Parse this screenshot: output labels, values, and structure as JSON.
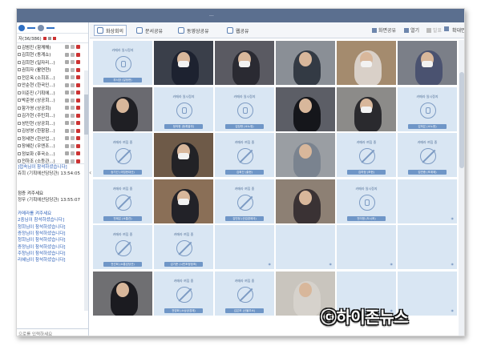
{
  "window": {
    "title_text": "...",
    "top_items": [
      "",
      "",
      ""
    ]
  },
  "sidebar": {
    "members_count": "자(36/386)",
    "members": [
      {
        "name": "김범진 (함께해)"
      },
      {
        "name": "김희현 (동계쇼)"
      },
      {
        "name": "김희현 (일자리...)"
      },
      {
        "name": "권희자 (활연현)"
      },
      {
        "name": "전은옥 (소희조...)"
      },
      {
        "name": "안순현 (한국인...)"
      },
      {
        "name": "이준진 (기획에...)"
      },
      {
        "name": "박준영 (상공회...)"
      },
      {
        "name": "함가영 (상공회)"
      },
      {
        "name": "김가현 (주민회...)"
      },
      {
        "name": "성민현 (상공회...)"
      },
      {
        "name": "김성영 (한함함...)"
      },
      {
        "name": "정세연 (한산업...)"
      },
      {
        "name": "장혜린 (우엔조...)"
      },
      {
        "name": "정보화 (후국소...)"
      },
      {
        "name": "전하조 (소등관...)"
      },
      {
        "name": "정지희 (신문화...)"
      },
      {
        "name": "박주영 (건설과)"
      },
      {
        "name": "정인정 (신년...)"
      }
    ],
    "chat_lines": [
      {
        "text": "]접속님이 참석하셨습니다]",
        "color": "blue"
      },
      {
        "text": "쥬희 (기획에산담당관) 13:54:05",
        "color": "dark"
      },
      {
        "text": "",
        "color": "blk"
      },
      {
        "text": "",
        "color": "blk"
      },
      {
        "text": "점증 켜주세요",
        "color": "blk"
      },
      {
        "text": "정무 (기획에산담당관) 13:55:07",
        "color": "dark"
      },
      {
        "text": "",
        "color": "blk"
      },
      {
        "text": "카메라를 켜주세요",
        "color": "blue"
      },
      {
        "text": "2중님이 참석하셨습니다]",
        "color": "blue"
      },
      {
        "text": "청희님이 참석하셨습니다]",
        "color": "blue"
      },
      {
        "text": "증정님이 참석하셨습니다]",
        "color": "blue"
      },
      {
        "text": "청희님이 참석하셨습니다]",
        "color": "blue"
      },
      {
        "text": "증정님이 참석하셨습니다]",
        "color": "blue"
      },
      {
        "text": "주청님이 참석하셨습니다]",
        "color": "blue"
      },
      {
        "text": "리혜님이 참석하셨습니다]",
        "color": "blue"
      }
    ],
    "chat_placeholder": "으로를 입력하세요"
  },
  "toolbar": {
    "tabs": [
      {
        "label": "화상회의",
        "active": true
      },
      {
        "label": "문서공유",
        "active": false
      },
      {
        "label": "동영상공유",
        "active": false
      },
      {
        "label": "웹공유",
        "active": false
      }
    ],
    "right": [
      "화면공유",
      "열기",
      "발표",
      "",
      "확대면"
    ]
  },
  "tiles": [
    {
      "state": "off",
      "caption": "카메라 일시정지",
      "icon": "person",
      "label": "부서장 (일정현)"
    },
    {
      "state": "video",
      "bg": "#3a3f4a",
      "body": "#1d2230",
      "label": ""
    },
    {
      "state": "video",
      "bg": "#5a5a62",
      "body": "#2a2a32",
      "label": ""
    },
    {
      "state": "video",
      "bg": "#8a8f96",
      "body": "#333a44",
      "label": ""
    },
    {
      "state": "video",
      "bg": "#a48b6e",
      "body": "#d9d0c8",
      "label": ""
    },
    {
      "state": "video",
      "bg": "#7b7f88",
      "body": "#4a5270",
      "label": ""
    },
    {
      "state": "video",
      "bg": "#6a6a70",
      "body": "#1f1f24",
      "label": ""
    },
    {
      "state": "off",
      "caption": "카메라 일시정지",
      "icon": "person",
      "label": "정의현 (등록출부)"
    },
    {
      "state": "off",
      "caption": "카메라 일시정지",
      "icon": "person",
      "label": "김당현 (소노정)"
    },
    {
      "state": "video",
      "bg": "#5c5e66",
      "body": "#15161b",
      "label": ""
    },
    {
      "state": "video",
      "bg": "#8c8b89",
      "body": "#2a2a2e",
      "label": ""
    },
    {
      "state": "off",
      "caption": "카메라 일시정지",
      "icon": "person",
      "label": "김하은 (소노현)"
    },
    {
      "state": "off",
      "caption": "카메라 꺼짐 중",
      "icon": "slash",
      "label": "송기선 (국립현대산)"
    },
    {
      "state": "video",
      "bg": "#6e5a48",
      "body": "#222226",
      "label": ""
    },
    {
      "state": "off",
      "caption": "카메라 꺼짐 중",
      "icon": "slash",
      "label": "김희진 (출현)"
    },
    {
      "state": "video",
      "bg": "#9a9ea3",
      "body": "#7a838f",
      "label": ""
    },
    {
      "state": "off",
      "caption": "카메라 꺼짐 중",
      "icon": "slash",
      "label": "김하정 (조현)"
    },
    {
      "state": "off",
      "caption": "카메라 꺼짐 중",
      "icon": "slash",
      "label": "김연중 (조계제)"
    },
    {
      "state": "off",
      "caption": "카메라 꺼짐 중",
      "icon": "slash",
      "label": "전제은 (소통관)"
    },
    {
      "state": "video",
      "bg": "#8a6f57",
      "body": "#222228",
      "label": ""
    },
    {
      "state": "off",
      "caption": "카메라 꺼짐 중",
      "icon": "slash",
      "label": "김민정 (산업경제국)"
    },
    {
      "state": "video",
      "bg": "#8d8074",
      "body": "#3a3234",
      "label": ""
    },
    {
      "state": "off",
      "caption": "카메라 일시정지",
      "icon": "person",
      "label": "전이정 (도시조)"
    },
    {
      "state": "off",
      "caption": "",
      "icon": "wm",
      "label": ""
    },
    {
      "state": "off",
      "caption": "카메라 꺼짐 중",
      "icon": "slash",
      "label": "전선희 (소통담당관)"
    },
    {
      "state": "off",
      "caption": "카메라 꺼짐 중",
      "icon": "slash",
      "label": "김기준 (시민조정정조)"
    },
    {
      "state": "off",
      "caption": "",
      "icon": "wm",
      "label": ""
    },
    {
      "state": "off",
      "caption": "",
      "icon": "wm",
      "label": ""
    },
    {
      "state": "off",
      "caption": "",
      "icon": "wm",
      "label": ""
    },
    {
      "state": "off",
      "caption": "",
      "icon": "wm",
      "label": ""
    },
    {
      "state": "video",
      "bg": "#6f6f72",
      "body": "#1b1b20",
      "label": ""
    },
    {
      "state": "off",
      "caption": "카메라 꺼짐 중",
      "icon": "slash",
      "label": "전영화 (소상공경제)"
    },
    {
      "state": "off",
      "caption": "카메라 꺼짐 중",
      "icon": "slash",
      "label": "김은보 (산불초소)"
    },
    {
      "state": "video",
      "bg": "#c9c5be",
      "body": "#d6d2cc",
      "label": ""
    },
    {
      "state": "off",
      "caption": "",
      "icon": "wm",
      "label": ""
    },
    {
      "state": "off",
      "caption": "",
      "icon": "wm",
      "label": ""
    }
  ],
  "watermark": "ⓒ하이존뉴스",
  "colors": {
    "accent": "#2f6fc3",
    "tile_off": "#d9e6f3",
    "label_bg": "#6f96c7"
  }
}
